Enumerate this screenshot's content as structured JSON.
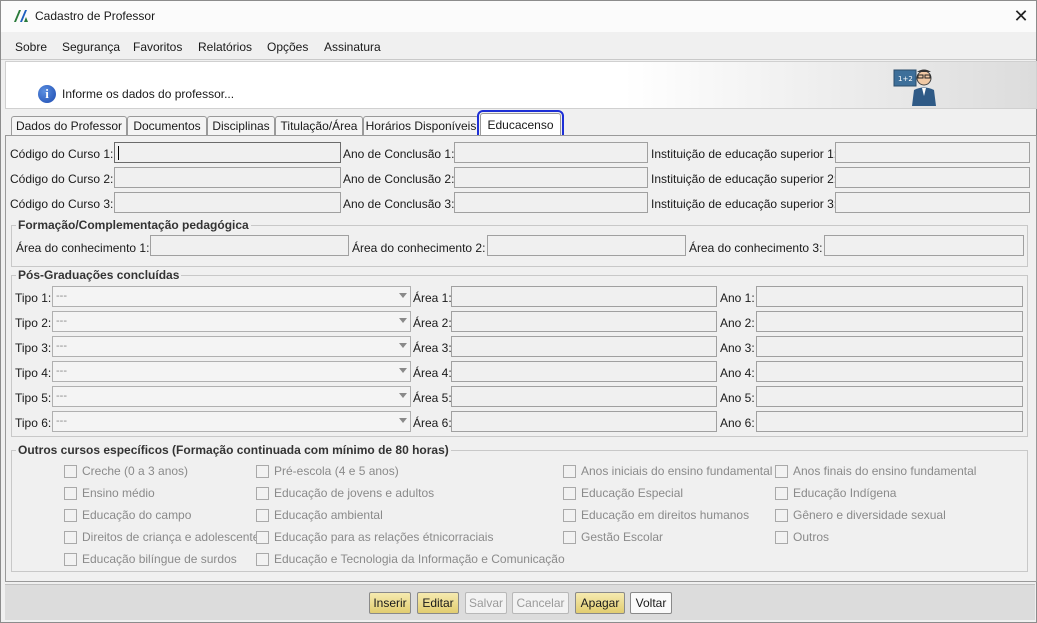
{
  "window": {
    "title": "Cadastro de Professor",
    "close_symbol": "✕"
  },
  "menu": [
    "Sobre",
    "Segurança",
    "Favoritos",
    "Relatórios",
    "Opções",
    "Assinatura"
  ],
  "header": {
    "message": "Informe os dados do professor...",
    "info_symbol": "i"
  },
  "tabs": [
    "Dados do Professor",
    "Documentos",
    "Disciplinas",
    "Titulação/Área",
    "Horários Disponíveis",
    "Educacenso"
  ],
  "active_tab": "Educacenso",
  "courses": {
    "rows": [
      {
        "code_label": "Código do Curso 1:",
        "year_label": "Ano de Conclusão 1:",
        "inst_label": "Instituição de educação superior 1:",
        "code": "",
        "year": "",
        "inst": ""
      },
      {
        "code_label": "Código do Curso 2:",
        "year_label": "Ano de Conclusão 2:",
        "inst_label": "Instituição de educação superior 2:",
        "code": "",
        "year": "",
        "inst": ""
      },
      {
        "code_label": "Código do Curso 3:",
        "year_label": "Ano de Conclusão 3:",
        "inst_label": "Instituição de educação superior 3:",
        "code": "",
        "year": "",
        "inst": ""
      }
    ]
  },
  "formacao": {
    "title": "Formação/Complementação pedagógica",
    "labels": [
      "Área do conhecimento 1:",
      "Área do conhecimento 2:",
      "Área do conhecimento 3:"
    ]
  },
  "pos": {
    "title": "Pós-Graduações concluídas",
    "rows": [
      {
        "tipo_label": "Tipo 1:",
        "tipo_value": "---",
        "area_label": "Área 1:",
        "ano_label": "Ano 1:"
      },
      {
        "tipo_label": "Tipo 2:",
        "tipo_value": "---",
        "area_label": "Área 2:",
        "ano_label": "Ano 2:"
      },
      {
        "tipo_label": "Tipo 3:",
        "tipo_value": "---",
        "area_label": "Área 3:",
        "ano_label": "Ano 3:"
      },
      {
        "tipo_label": "Tipo 4:",
        "tipo_value": "---",
        "area_label": "Área 4:",
        "ano_label": "Ano 4:"
      },
      {
        "tipo_label": "Tipo 5:",
        "tipo_value": "---",
        "area_label": "Área 5:",
        "ano_label": "Ano 5:"
      },
      {
        "tipo_label": "Tipo 6:",
        "tipo_value": "---",
        "area_label": "Área 6:",
        "ano_label": "Ano 6:"
      }
    ]
  },
  "outros": {
    "title": "Outros cursos específicos (Formação continuada com mínimo de 80 horas)",
    "items": [
      "Creche (0 a 3 anos)",
      "Pré-escola (4 e 5 anos)",
      "Anos iniciais do ensino fundamental",
      "Anos finais do ensino fundamental",
      "Ensino médio",
      "Educação de jovens e adultos",
      "Educação Especial",
      "Educação Indígena",
      "Educação do campo",
      "Educação ambiental",
      "Educação em direitos humanos",
      "Gênero e diversidade sexual",
      "Direitos de criança e adolescente",
      "Educação para as relações étnicorraciais",
      "Gestão Escolar",
      "Outros",
      "Educação bilíngue de surdos",
      "Educação e Tecnologia da Informação e Comunicação"
    ]
  },
  "buttons": [
    "Inserir",
    "Editar",
    "Salvar",
    "Cancelar",
    "Apagar",
    "Voltar"
  ],
  "colors": {
    "active_tab_outline": "#1d2fd6",
    "button_yellow": "#e2cd70",
    "disabled_text": "#9a9a9a"
  }
}
